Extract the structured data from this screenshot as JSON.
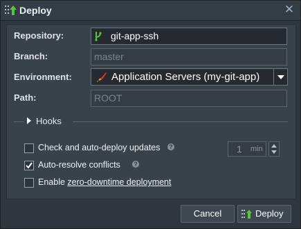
{
  "dialog": {
    "title": "Deploy",
    "close_icon": "close-icon"
  },
  "form": {
    "repository": {
      "label": "Repository:",
      "value": "git-app-ssh",
      "icon": "git-branch-icon"
    },
    "branch": {
      "label": "Branch:",
      "value": "master"
    },
    "environment": {
      "label": "Environment:",
      "value": "Application Servers (my-git-app)",
      "icon": "rocket-icon"
    },
    "path": {
      "label": "Path:",
      "value": "ROOT"
    }
  },
  "hooks": {
    "label": "Hooks",
    "expanded": false
  },
  "options": {
    "auto_deploy": {
      "label": "Check and auto-deploy updates",
      "checked": false
    },
    "interval": {
      "value": "1",
      "unit": "min"
    },
    "auto_resolve": {
      "label": "Auto-resolve conflicts",
      "checked": true
    },
    "zdt": {
      "prefix": "Enable ",
      "link": "zero-downtime deployment",
      "checked": false
    },
    "help_glyph": "?"
  },
  "buttons": {
    "cancel": "Cancel",
    "deploy": "Deploy"
  },
  "colors": {
    "accent_green": "#58c33f",
    "check_white": "#ffffff",
    "rocket_red": "#d9342b"
  }
}
